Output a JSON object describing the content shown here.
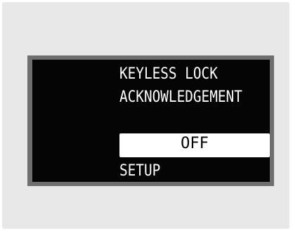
{
  "display": {
    "line1": "KEYLESS LOCK",
    "line2": "ACKNOWLEDGEMENT",
    "selected_option": "OFF",
    "line4": "SETUP"
  },
  "colors": {
    "screen_background": "#050505",
    "text": "#ffffff",
    "highlight": "#ffffff",
    "highlight_text": "#000000",
    "frame": "#6f6f6f",
    "panel": "#e8e8e8"
  }
}
